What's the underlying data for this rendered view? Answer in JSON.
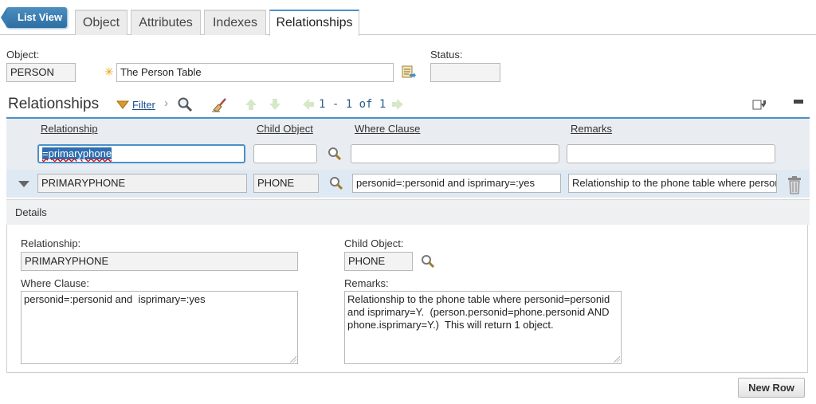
{
  "tabs": {
    "list_view": "List View",
    "items": [
      "Object",
      "Attributes",
      "Indexes",
      "Relationships"
    ],
    "active": "Relationships"
  },
  "header": {
    "object_label": "Object:",
    "object_value": "PERSON",
    "description_value": "The Person Table",
    "status_label": "Status:",
    "status_value": ""
  },
  "table": {
    "title": "Relationships",
    "filter_label": "Filter",
    "pager": "1 - 1 of 1",
    "columns": [
      "Relationship",
      "Child Object",
      "Where Clause",
      "Remarks"
    ],
    "filter": {
      "relationship": "=primaryphone",
      "child_object": "",
      "where_clause": "",
      "remarks": ""
    },
    "rows": [
      {
        "relationship": "PRIMARYPHONE",
        "child_object": "PHONE",
        "where_clause": "personid=:personid and  isprimary=:yes",
        "remarks": "Relationship to the phone table where personid"
      }
    ]
  },
  "details": {
    "title": "Details",
    "relationship_label": "Relationship:",
    "relationship_value": "PRIMARYPHONE",
    "child_object_label": "Child Object:",
    "child_object_value": "PHONE",
    "where_clause_label": "Where Clause:",
    "where_clause_value": "personid=:personid and  isprimary=:yes",
    "remarks_label": "Remarks:",
    "remarks_value": "Relationship to the phone table where personid=personid\nand isprimary=Y.  (person.personid=phone.personid AND\nphone.isprimary=Y.)  This will return 1 object."
  },
  "new_row_label": "New Row",
  "colors": {
    "accent": "#4a90c8",
    "list_view_bg": "#2e6fa3",
    "row_selected": "#dfe9f3",
    "header_bg": "#e9edf1",
    "required_star": "#e6a100"
  }
}
